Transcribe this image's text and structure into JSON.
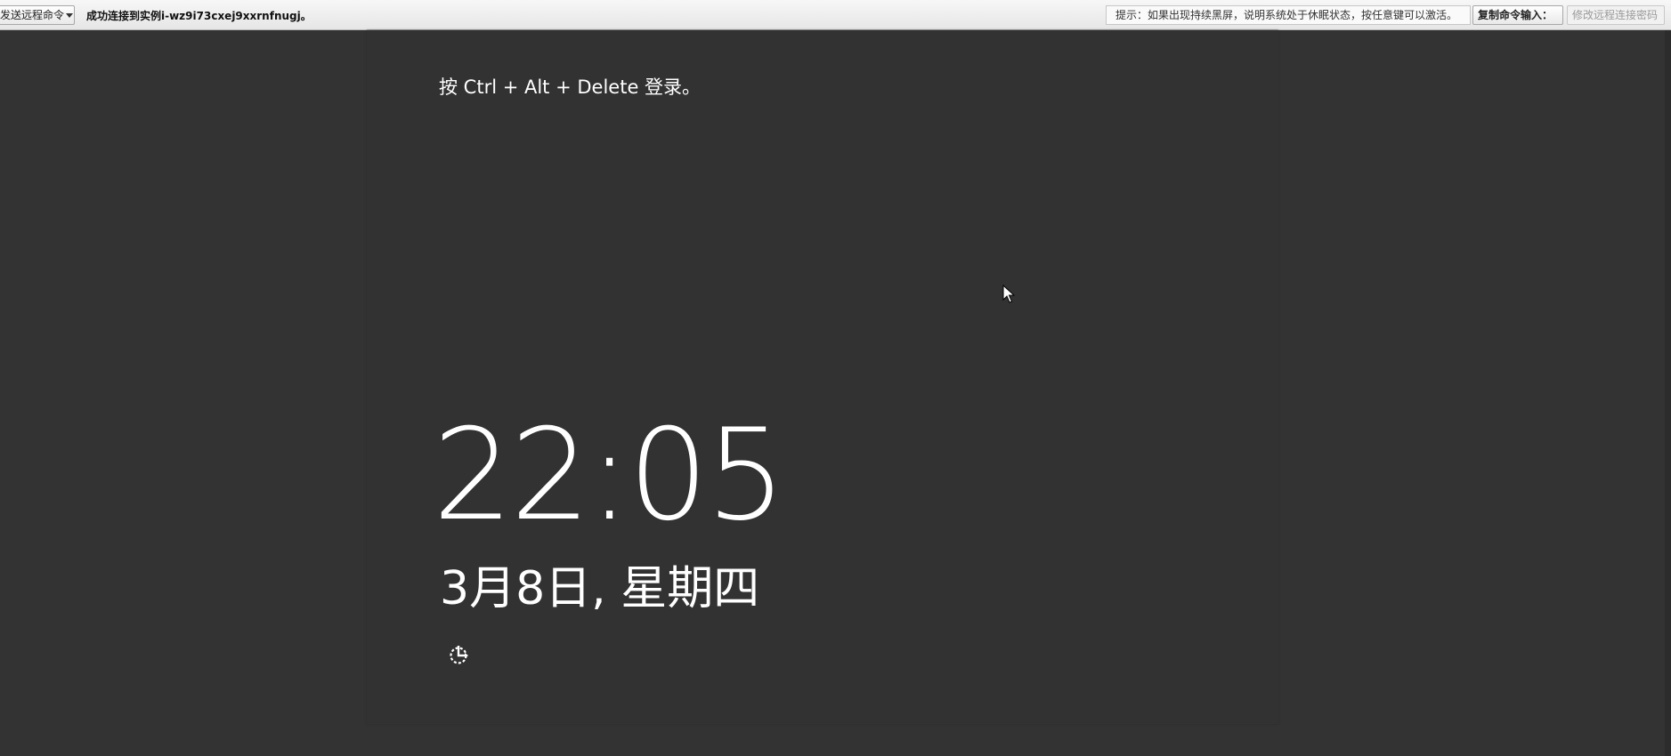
{
  "toolbar": {
    "send_command_label": "发送远程命令",
    "status_message": "成功连接到实例i-wz9i73cxej9xxrnfnugj。",
    "hint_text": "提示：如果出现持续黑屏，说明系统处于休眠状态，按任意键可以激活。",
    "copy_command_label": "复制命令输入：",
    "change_password_label": "修改远程连接密码"
  },
  "lock_screen": {
    "login_prompt": "按 Ctrl + Alt + Delete 登录。",
    "time": "22:05",
    "date": "3月8日, 星期四",
    "ease_of_access_icon": "ease-of-access-icon"
  },
  "colors": {
    "background": "#333333",
    "text": "#ffffff",
    "toolbar": "#eeeeee"
  }
}
